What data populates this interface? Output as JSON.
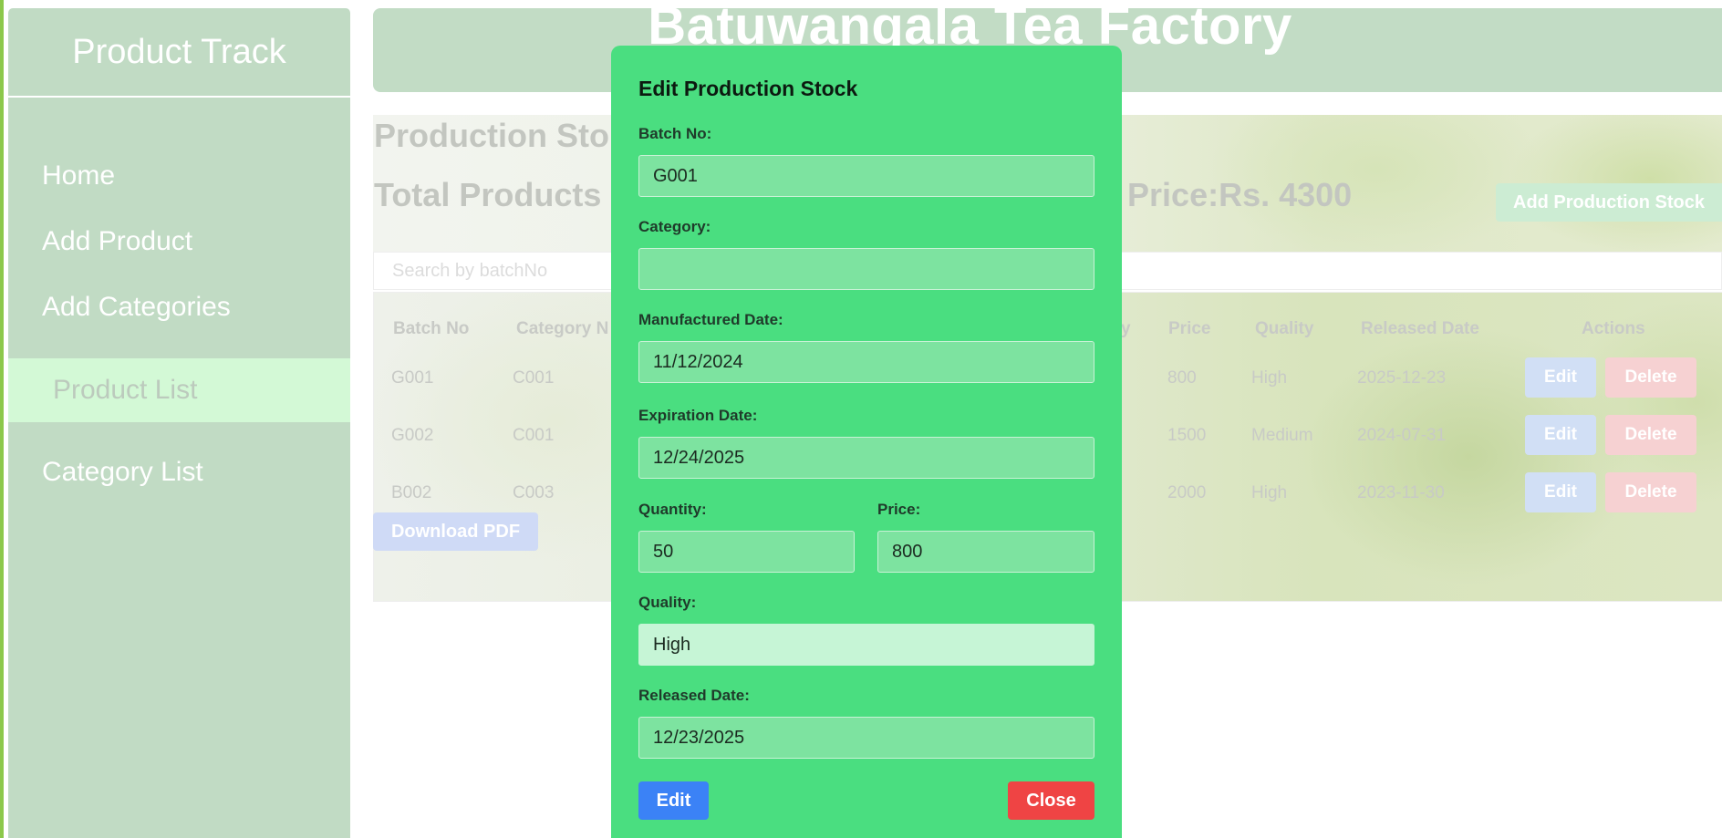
{
  "sidebar": {
    "title": "Product Track",
    "items": [
      {
        "label": "Home"
      },
      {
        "label": "Add Product"
      },
      {
        "label": "Add Categories"
      },
      {
        "label": "Product List",
        "active": true
      },
      {
        "label": "Category List"
      }
    ]
  },
  "header": {
    "title": "Batuwangala Tea Factory"
  },
  "main": {
    "title": "Production Sto",
    "totals_products": "Total Products",
    "totals_price": "al Price:Rs. 4300",
    "add_button": "Add Production Stock",
    "search_placeholder": "Search by batchNo",
    "table": {
      "headers": {
        "batch": "Batch No",
        "category": "Category N",
        "qty_tail": "y",
        "price": "Price",
        "quality": "Quality",
        "released": "Released Date",
        "actions": "Actions"
      },
      "rows": [
        {
          "batch": "G001",
          "category": "C001",
          "price": "800",
          "quality": "High",
          "released": "2025-12-23"
        },
        {
          "batch": "G002",
          "category": "C001",
          "price": "1500",
          "quality": "Medium",
          "released": "2024-07-31"
        },
        {
          "batch": "B002",
          "category": "C003",
          "price": "2000",
          "quality": "High",
          "released": "2023-11-30"
        }
      ],
      "edit_label": "Edit",
      "delete_label": "Delete"
    },
    "pdf_button": "Download PDF"
  },
  "modal": {
    "title": "Edit Production Stock",
    "batch_label": "Batch No:",
    "batch_value": "G001",
    "category_label": "Category:",
    "category_value": "",
    "mfg_label": "Manufactured Date:",
    "mfg_value": "11/12/2024",
    "exp_label": "Expiration Date:",
    "exp_value": "12/24/2025",
    "quantity_label": "Quantity:",
    "quantity_value": "50",
    "price_label": "Price:",
    "price_value": "800",
    "quality_label": "Quality:",
    "quality_value": "High",
    "released_label": "Released Date:",
    "released_value": "12/23/2025",
    "edit_button": "Edit",
    "close_button": "Close"
  },
  "colors": {
    "modal_bg": "#4ade80",
    "edit_blue": "#3b82f6",
    "close_red": "#ef4444",
    "sidebar_bg": "#c1dbc4"
  }
}
